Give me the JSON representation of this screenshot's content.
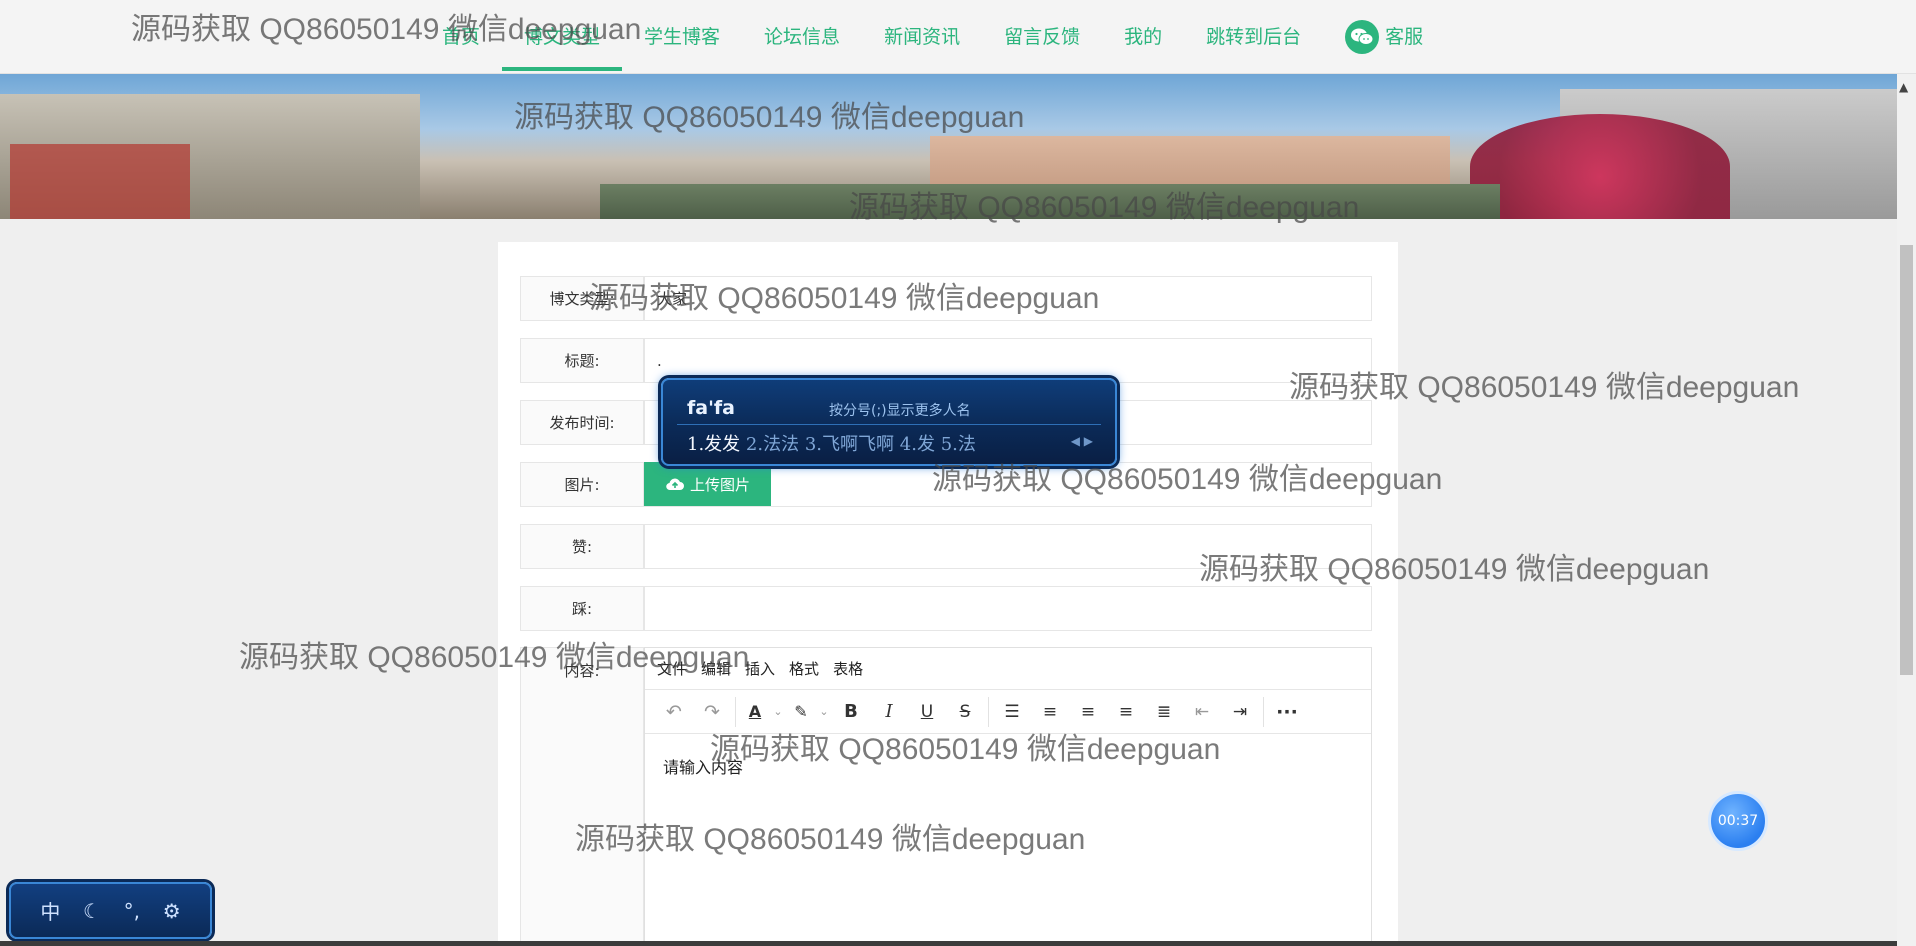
{
  "nav": {
    "items": [
      {
        "label": "首页"
      },
      {
        "label": "博文类型"
      },
      {
        "label": "学生博客"
      },
      {
        "label": "论坛信息"
      },
      {
        "label": "新闻资讯"
      },
      {
        "label": "留言反馈"
      },
      {
        "label": "我的"
      },
      {
        "label": "跳转到后台"
      }
    ],
    "service_label": "客服",
    "active_index": 1,
    "accent": "#2cb57e"
  },
  "form": {
    "type_label": "博文类型:",
    "type_value": "大家",
    "title_label": "标题:",
    "title_value": ".",
    "time_label": "发布时间:",
    "image_label": "图片:",
    "upload_label": "上传图片",
    "like_label": "赞:",
    "dislike_label": "踩:",
    "content_label": "内容:"
  },
  "editor": {
    "menu": [
      "文件",
      "编辑",
      "插入",
      "格式",
      "表格"
    ],
    "placeholder": "请输入内容"
  },
  "ime": {
    "input": "fa'fa",
    "hint": "按分号(;)显示更多人名",
    "c1": "1.发发",
    "c2": "2.法法",
    "c3": "3.飞啊飞啊",
    "c4": "4.发",
    "c5": "5.法",
    "status_lang": "中"
  },
  "timer": "00:37",
  "watermark_text": "源码获取 QQ86050149 微信deepguan"
}
